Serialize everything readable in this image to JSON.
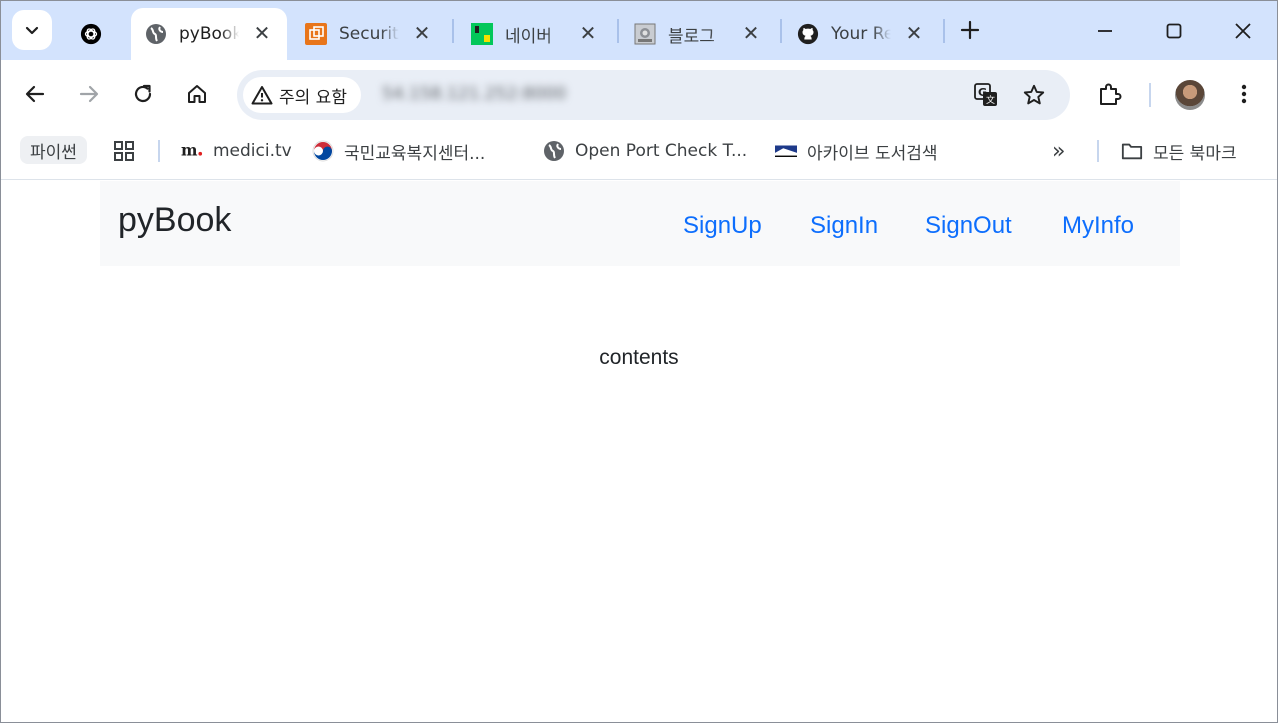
{
  "browser": {
    "tabs": [
      {
        "title": "pyBook",
        "favicon": "globe-icon",
        "active": true
      },
      {
        "title": "Security",
        "favicon": "aws-security-icon",
        "active": false
      },
      {
        "title": "네이버",
        "favicon": "naver-icon",
        "active": false
      },
      {
        "title": "블로그",
        "favicon": "blog-icon",
        "active": false
      },
      {
        "title": "Your Re",
        "favicon": "github-icon",
        "active": false
      }
    ],
    "security_chip": "주의 요함",
    "url": "54.158.121.252:8000",
    "bookmarks": {
      "folder_label": "파이썬",
      "items": [
        {
          "label": "medici.tv",
          "icon": "medici-icon"
        },
        {
          "label": "국민교육복지센터...",
          "icon": "korea-emblem-icon"
        },
        {
          "label": "Open Port Check T...",
          "icon": "globe-icon"
        },
        {
          "label": "아카이브 도서검색",
          "icon": "archive-flag-icon"
        }
      ],
      "overflow_label": "»",
      "all_bookmarks_label": "모든 북마크"
    }
  },
  "page": {
    "brand": "pyBook",
    "nav_links": [
      "SignUp",
      "SignIn",
      "SignOut",
      "MyInfo"
    ],
    "contents": "contents"
  },
  "colors": {
    "tabstrip": "#d3e3fd",
    "omnibox": "#e9eef6",
    "navbar_bg": "#f8f9fa",
    "link": "#0d6efd",
    "text": "#212529"
  }
}
